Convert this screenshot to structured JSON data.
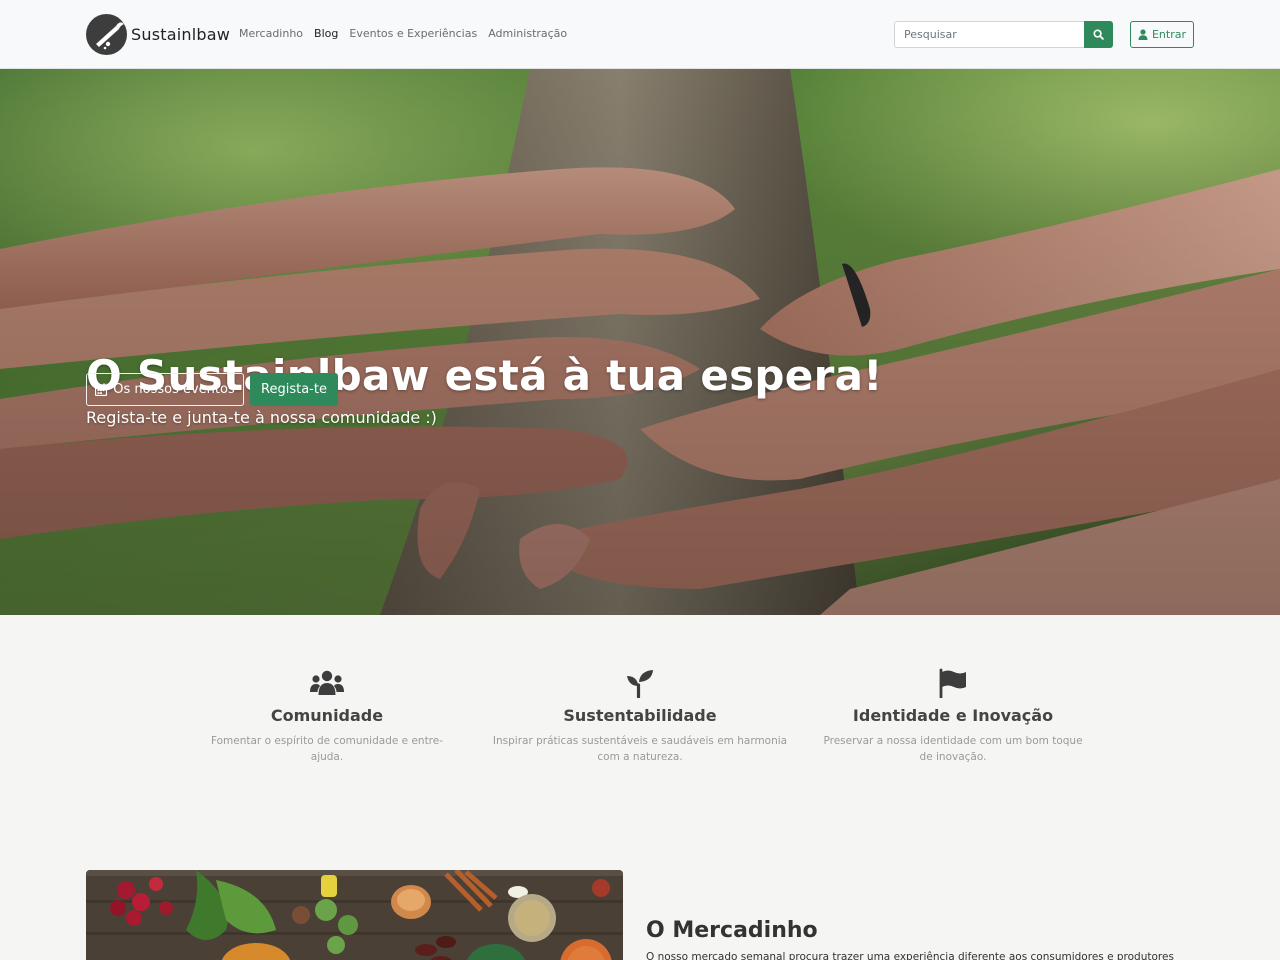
{
  "brand": {
    "name": "Sustainlbaw"
  },
  "nav": {
    "items": [
      {
        "label": "Mercadinho",
        "active": false
      },
      {
        "label": "Blog",
        "active": true
      },
      {
        "label": "Eventos e Experiências",
        "active": false
      },
      {
        "label": "Administração",
        "active": false
      }
    ]
  },
  "search": {
    "placeholder": "Pesquisar"
  },
  "login": {
    "label": "Entrar"
  },
  "hero": {
    "title": "O Sustainlbaw está à tua espera!",
    "subtitle": "Regista-te e junta-te à nossa comunidade :)",
    "events_button": "Os nossos eventos",
    "register_button": "Regista-te"
  },
  "features": [
    {
      "icon": "users-icon",
      "title": "Comunidade",
      "description": "Fomentar o espírito de comunidade e entre-ajuda."
    },
    {
      "icon": "seedling-icon",
      "title": "Sustentabilidade",
      "description": "Inspirar práticas sustentáveis e saudáveis em harmonia com a natureza."
    },
    {
      "icon": "flag-icon",
      "title": "Identidade e Inovação",
      "description": "Preservar a nossa identidade com um bom toque de inovação."
    }
  ],
  "market": {
    "title": "O Mercadinho",
    "text": "O nosso mercado semanal procura trazer uma experiência diferente aos consumidores e produtores"
  },
  "colors": {
    "accent": "#2e8a5b",
    "navbar": "#f8f9fa",
    "background": "#f5f5f3"
  }
}
